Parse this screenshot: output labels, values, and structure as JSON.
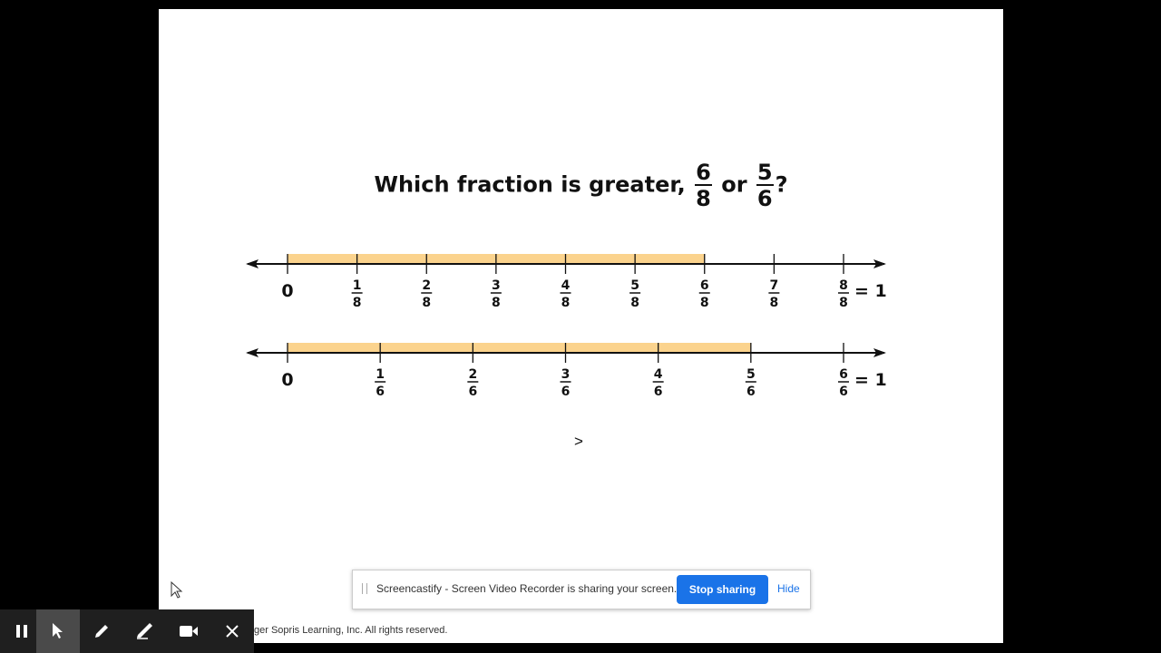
{
  "question": {
    "prefix": "Which fraction is greater, ",
    "frac1": {
      "num": "6",
      "den": "8"
    },
    "connector": " or ",
    "frac2": {
      "num": "5",
      "den": "6"
    },
    "suffix": "?"
  },
  "eighths_line": {
    "ticks": [
      {
        "whole": "0"
      },
      {
        "num": "1",
        "den": "8"
      },
      {
        "num": "2",
        "den": "8"
      },
      {
        "num": "3",
        "den": "8"
      },
      {
        "num": "4",
        "den": "8"
      },
      {
        "num": "5",
        "den": "8"
      },
      {
        "num": "6",
        "den": "8"
      },
      {
        "num": "7",
        "den": "8"
      },
      {
        "num": "8",
        "den": "8",
        "suffix": "= 1"
      }
    ],
    "shaded_fraction": 0.75
  },
  "sixths_line": {
    "ticks": [
      {
        "whole": "0"
      },
      {
        "num": "1",
        "den": "6"
      },
      {
        "num": "2",
        "den": "6"
      },
      {
        "num": "3",
        "den": "6"
      },
      {
        "num": "4",
        "den": "6"
      },
      {
        "num": "5",
        "den": "6"
      },
      {
        "num": "6",
        "den": "6",
        "suffix": "= 1"
      }
    ],
    "shaded_fraction": 0.8333
  },
  "answer_symbol": ">",
  "copyright": "ger Sopris Learning, Inc. All rights reserved.",
  "share_bar": {
    "message": "Screencastify - Screen Video Recorder is sharing your screen.",
    "stop_label": "Stop sharing",
    "hide_label": "Hide"
  },
  "toolbar": {
    "tools": [
      {
        "icon": "pause-icon",
        "active": false
      },
      {
        "icon": "pointer-icon",
        "active": true
      },
      {
        "icon": "pen-icon",
        "active": false
      },
      {
        "icon": "eraser-icon",
        "active": false
      },
      {
        "icon": "camera-icon",
        "active": false
      },
      {
        "icon": "close-icon",
        "active": false
      }
    ]
  },
  "colors": {
    "highlight": "#fbd38d",
    "accent": "#1a73e8",
    "toolbar_bg": "#1f1f1f",
    "toolbar_active": "#4a4a4a"
  }
}
